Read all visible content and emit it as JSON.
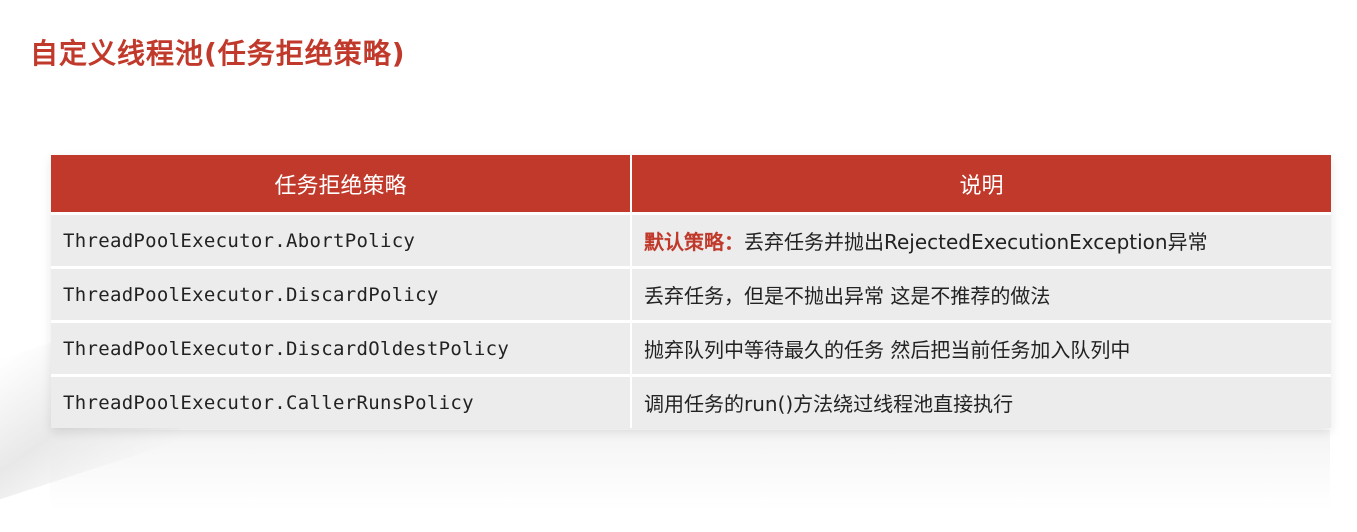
{
  "title": "自定义线程池(任务拒绝策略)",
  "table": {
    "headers": [
      "任务拒绝策略",
      "说明"
    ],
    "rows": [
      {
        "policy": "ThreadPoolExecutor.AbortPolicy",
        "highlight": "默认策略：",
        "description": "丢弃任务并抛出RejectedExecutionException异常"
      },
      {
        "policy": "ThreadPoolExecutor.DiscardPolicy",
        "highlight": "",
        "description": "丢弃任务，但是不抛出异常 这是不推荐的做法"
      },
      {
        "policy": "ThreadPoolExecutor.DiscardOldestPolicy",
        "highlight": "",
        "description": "抛弃队列中等待最久的任务 然后把当前任务加入队列中"
      },
      {
        "policy": "ThreadPoolExecutor.CallerRunsPolicy",
        "highlight": "",
        "description": "调用任务的run()方法绕过线程池直接执行"
      }
    ]
  },
  "colors": {
    "accent": "#c0392b",
    "row_background": "#ececec"
  }
}
